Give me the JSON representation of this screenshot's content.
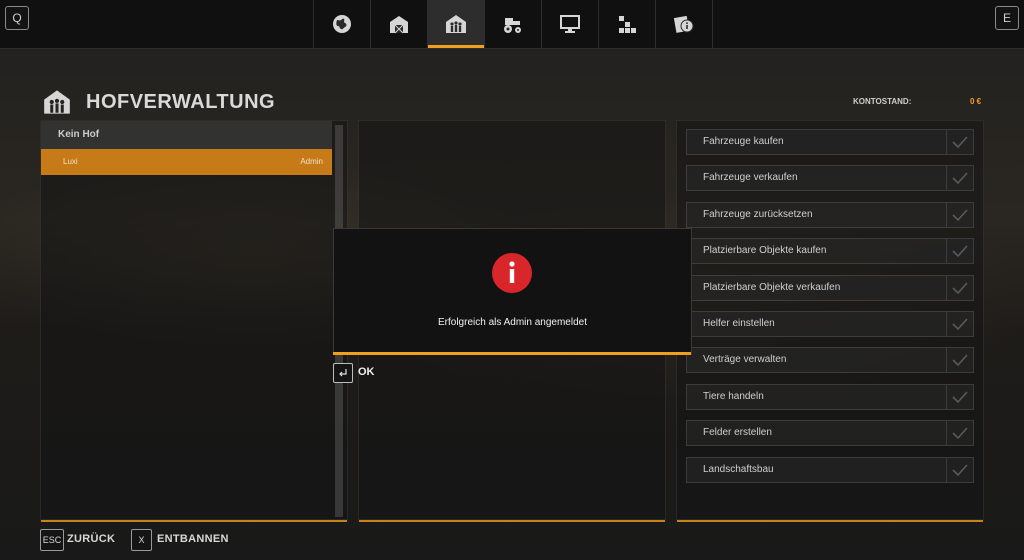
{
  "topbar": {
    "left_key": "Q",
    "right_key": "E",
    "tabs": [
      {
        "icon": "globe-icon"
      },
      {
        "icon": "barn-icon"
      },
      {
        "icon": "farm-management-icon",
        "active": true
      },
      {
        "icon": "tractor-icon"
      },
      {
        "icon": "monitor-icon"
      },
      {
        "icon": "pallets-icon"
      },
      {
        "icon": "info-docs-icon"
      }
    ]
  },
  "header": {
    "title": "HOFVERWALTUNG",
    "balance_label": "KONTOSTAND:",
    "balance_value": "0 €"
  },
  "farm_list": {
    "header": "Kein Hof",
    "players": [
      {
        "name": "Luxi",
        "role": "Admin"
      }
    ]
  },
  "permissions": [
    "Fahrzeuge kaufen",
    "Fahrzeuge verkaufen",
    "Fahrzeuge zurücksetzen",
    "Platzierbare Objekte kaufen",
    "Platzierbare Objekte verkaufen",
    "Helfer einstellen",
    "Verträge verwalten",
    "Tiere handeln",
    "Felder erstellen",
    "Landschaftsbau"
  ],
  "dialog": {
    "message": "Erfolgreich als Admin angemeldet",
    "ok_label": "OK"
  },
  "footer": {
    "back_key": "ESC",
    "back_label": "ZURÜCK",
    "unban_key": "X",
    "unban_label": "ENTBANNEN"
  },
  "colors": {
    "accent": "#f0a020",
    "selected_row": "#c77a18",
    "alert_red": "#d8262a"
  }
}
